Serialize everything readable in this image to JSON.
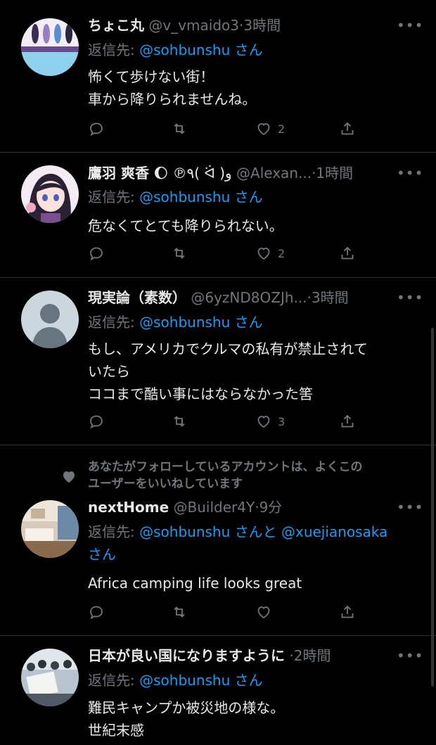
{
  "tweets": [
    {
      "name": "ちょこ丸",
      "handle": "@v_vmaido3",
      "time": "3時間",
      "reply_prefix": "返信先: ",
      "reply_to": "@sohbunshu",
      "reply_suffix": " さん",
      "text": "怖くて歩けない街！\n車から降りられませんね。",
      "likes": "2",
      "avatar_icon": "fashion-illustration-avatar"
    },
    {
      "name": "鷹羽 爽香",
      "name_extra": "🌔 ℗٩( ᐛ )و",
      "handle": "@Alexan...",
      "time": "1時間",
      "reply_prefix": "返信先: ",
      "reply_to": "@sohbunshu",
      "reply_suffix": " さん",
      "text": "危なくてとても降りられない。",
      "likes": "2",
      "avatar_icon": "anime-girl-avatar"
    },
    {
      "name": "現実論（素数）",
      "handle": "@6yzND8OZJh...",
      "time": "3時間",
      "reply_prefix": "返信先: ",
      "reply_to": "@sohbunshu",
      "reply_suffix": " さん",
      "text": "もし、アメリカでクルマの私有が禁止されて\nいたら\nココまで酷い事にはならなかった筈",
      "likes": "3",
      "avatar_icon": "default-profile-avatar"
    },
    {
      "social_context": "あなたがフォローしているアカウントは、よくこの\nユーザーをいいねしています",
      "name": "nextHome",
      "handle": "@Builder4Y",
      "time": "9分",
      "reply_prefix": "返信先: ",
      "reply_to": "@sohbunshu",
      "reply_mid": " さんと ",
      "reply_to2": "@xuejianosaka",
      "reply_suffix": "さん",
      "text": "Africa camping life looks great",
      "likes": "",
      "avatar_icon": "interior-room-avatar"
    },
    {
      "name": "日本が良い国になりますように",
      "handle": "",
      "time": "2時間",
      "reply_prefix": "返信先: ",
      "reply_to": "@sohbunshu",
      "reply_suffix": " さん",
      "text": "難民キャンプか被災地の様な。\n世紀末感",
      "avatar_icon": "protest-crowd-avatar"
    }
  ],
  "separator": "·",
  "more_label": "•••",
  "colors": {
    "background": "#000000",
    "link": "#1d9bf0",
    "muted": "#71767b",
    "text": "#e7e9ea",
    "divider": "#2f3336"
  }
}
